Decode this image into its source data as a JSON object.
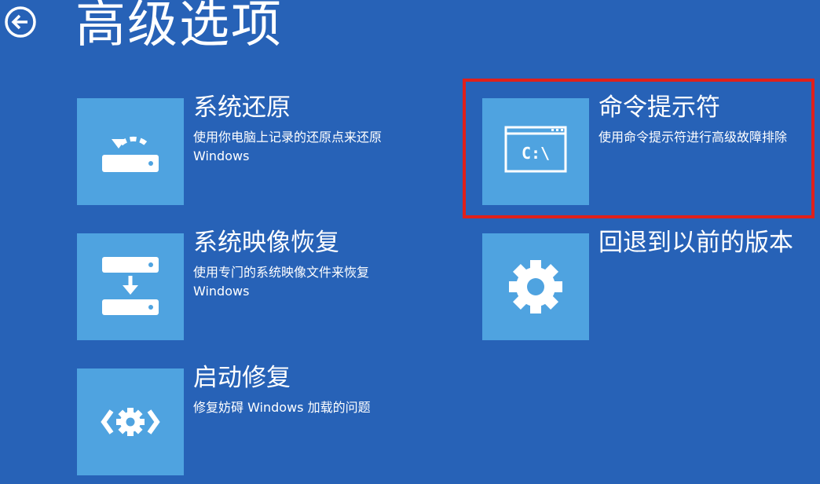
{
  "header": {
    "back_icon": "back-arrow-icon",
    "title": "高级选项"
  },
  "options": [
    {
      "title": "系统还原",
      "description": "使用你电脑上记录的还原点来还原 Windows",
      "icon": "system-restore-icon"
    },
    {
      "title": "命令提示符",
      "description": "使用命令提示符进行高级故障排除",
      "icon": "command-prompt-icon",
      "icon_text": "C:\\"
    },
    {
      "title": "系统映像恢复",
      "description": "使用专门的系统映像文件来恢复 Windows",
      "icon": "system-image-recovery-icon"
    },
    {
      "title": "回退到以前的版本",
      "description": "",
      "icon": "gear-icon"
    },
    {
      "title": "启动修复",
      "description": "修复妨碍 Windows 加载的问题",
      "icon": "startup-repair-icon"
    }
  ],
  "colors": {
    "background": "#2762b7",
    "tile": "#4fa3e0",
    "highlight": "#e0201b"
  }
}
